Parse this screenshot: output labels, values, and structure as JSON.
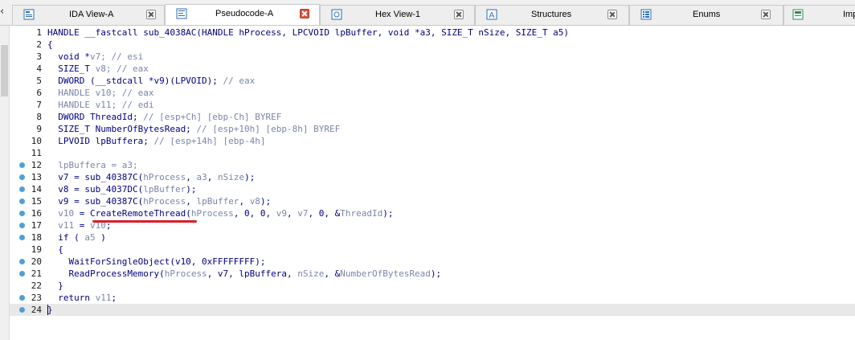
{
  "tabs": [
    {
      "label": "IDA View-A",
      "icon": "ida-view-icon",
      "active": false
    },
    {
      "label": "Pseudocode-A",
      "icon": "pseudocode-icon",
      "active": true
    },
    {
      "label": "Hex View-1",
      "icon": "hex-view-icon",
      "active": false
    },
    {
      "label": "Structures",
      "icon": "structures-icon",
      "active": false
    },
    {
      "label": "Enums",
      "icon": "enums-icon",
      "active": false
    },
    {
      "label": "Imp",
      "icon": "imports-icon",
      "active": false
    }
  ],
  "colors": {
    "accent_underline": "#d81e2a",
    "active_close": "#d9533f",
    "breakpoint_dot": "#4ea0d8",
    "keyword": "#000080",
    "comment_var": "#7a86a8"
  },
  "code": {
    "lines": [
      {
        "n": "1",
        "dot": false,
        "segs": [
          [
            "HANDLE __fastcall sub_4038AC(HANDLE hProcess, LPCVOID lpBuffer, void *a3, SIZE_T nSize, SIZE_T a5)",
            "kw"
          ]
        ]
      },
      {
        "n": "2",
        "dot": false,
        "segs": [
          [
            "{",
            "kw"
          ]
        ]
      },
      {
        "n": "3",
        "dot": false,
        "segs": [
          [
            "  void *",
            "kw"
          ],
          [
            "v7",
            "var"
          ],
          [
            "; // esi",
            "cmt"
          ]
        ]
      },
      {
        "n": "4",
        "dot": false,
        "segs": [
          [
            "  SIZE_T ",
            "kw"
          ],
          [
            "v8",
            "var"
          ],
          [
            "; // eax",
            "cmt"
          ]
        ]
      },
      {
        "n": "5",
        "dot": false,
        "segs": [
          [
            "  DWORD (__stdcall *v9)(LPVOID); ",
            "blk"
          ],
          [
            "// eax",
            "cmt"
          ]
        ]
      },
      {
        "n": "6",
        "dot": false,
        "segs": [
          [
            "  HANDLE v10; // eax",
            "cmt"
          ]
        ]
      },
      {
        "n": "7",
        "dot": false,
        "segs": [
          [
            "  HANDLE v11; // edi",
            "cmt"
          ]
        ]
      },
      {
        "n": "8",
        "dot": false,
        "segs": [
          [
            "  DWORD ThreadId; ",
            "blk"
          ],
          [
            "// [esp+Ch] [ebp-Ch] BYREF",
            "cmt"
          ]
        ]
      },
      {
        "n": "9",
        "dot": false,
        "segs": [
          [
            "  SIZE_T NumberOfBytesRead; ",
            "blk"
          ],
          [
            "// [esp+10h] [ebp-8h] BYREF",
            "cmt"
          ]
        ]
      },
      {
        "n": "10",
        "dot": false,
        "segs": [
          [
            "  LPVOID lpBuffera; ",
            "blk"
          ],
          [
            "// [esp+14h] [ebp-4h]",
            "cmt"
          ]
        ]
      },
      {
        "n": "11",
        "dot": false,
        "segs": [
          [
            "",
            "kw"
          ]
        ]
      },
      {
        "n": "12",
        "dot": true,
        "segs": [
          [
            "  lpBuffera = a3;",
            "cmt"
          ]
        ]
      },
      {
        "n": "13",
        "dot": true,
        "segs": [
          [
            "  v7 = sub_40387C(",
            "blk"
          ],
          [
            "hProcess",
            "var"
          ],
          [
            ", ",
            "blk"
          ],
          [
            "a3",
            "var"
          ],
          [
            ", ",
            "blk"
          ],
          [
            "nSize",
            "var"
          ],
          [
            ");",
            "blk"
          ]
        ]
      },
      {
        "n": "14",
        "dot": true,
        "segs": [
          [
            "  v8 = sub_4037DC(",
            "blk"
          ],
          [
            "lpBuffer",
            "var"
          ],
          [
            ");",
            "blk"
          ]
        ]
      },
      {
        "n": "15",
        "dot": true,
        "segs": [
          [
            "  v9 = sub_40387C(",
            "blk"
          ],
          [
            "hProcess",
            "var"
          ],
          [
            ", ",
            "blk"
          ],
          [
            "lpBuffer",
            "var"
          ],
          [
            ", ",
            "blk"
          ],
          [
            "v8",
            "var"
          ],
          [
            ");",
            "blk"
          ]
        ]
      },
      {
        "n": "16",
        "dot": true,
        "segs": [
          [
            "  ",
            "blk"
          ],
          [
            "v10",
            "var"
          ],
          [
            " = CreateRemoteThread(",
            "blk"
          ],
          [
            "hProcess",
            "var"
          ],
          [
            ", 0, 0, ",
            "blk"
          ],
          [
            "v9",
            "var"
          ],
          [
            ", ",
            "blk"
          ],
          [
            "v7",
            "var"
          ],
          [
            ", 0, &",
            "blk"
          ],
          [
            "ThreadId",
            "var"
          ],
          [
            ");",
            "blk"
          ]
        ]
      },
      {
        "n": "17",
        "dot": true,
        "segs": [
          [
            "  ",
            "blk"
          ],
          [
            "v11",
            "var"
          ],
          [
            " = ",
            "blk"
          ],
          [
            "v10",
            "var"
          ],
          [
            ";",
            "blk"
          ]
        ]
      },
      {
        "n": "18",
        "dot": true,
        "segs": [
          [
            "  if ( ",
            "blk"
          ],
          [
            "a5",
            "var"
          ],
          [
            " )",
            "blk"
          ]
        ]
      },
      {
        "n": "19",
        "dot": false,
        "segs": [
          [
            "  {",
            "blk"
          ]
        ]
      },
      {
        "n": "20",
        "dot": true,
        "segs": [
          [
            "    WaitForSingleObject(v10, 0xFFFFFFFF);",
            "blk"
          ]
        ]
      },
      {
        "n": "21",
        "dot": true,
        "segs": [
          [
            "    ReadProcessMemory(",
            "blk"
          ],
          [
            "hProcess",
            "var"
          ],
          [
            ", v7, lpBuffera, ",
            "blk"
          ],
          [
            "nSize",
            "var"
          ],
          [
            ", &",
            "blk"
          ],
          [
            "NumberOfBytesRead",
            "var"
          ],
          [
            ");",
            "blk"
          ]
        ]
      },
      {
        "n": "22",
        "dot": false,
        "segs": [
          [
            "  }",
            "blk"
          ]
        ]
      },
      {
        "n": "23",
        "dot": true,
        "segs": [
          [
            "  return ",
            "blk"
          ],
          [
            "v11",
            "var"
          ],
          [
            ";",
            "blk"
          ]
        ]
      },
      {
        "n": "24",
        "dot": true,
        "segs": [
          [
            "}",
            "blk"
          ]
        ]
      }
    ]
  }
}
